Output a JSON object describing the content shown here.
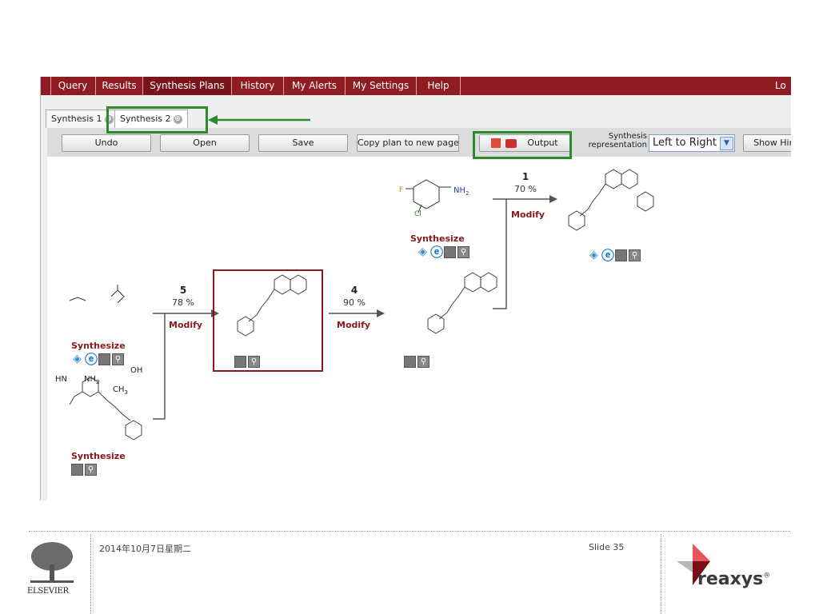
{
  "nav": {
    "items": [
      "Query",
      "Results",
      "Synthesis Plans",
      "History",
      "My Alerts",
      "My Settings",
      "Help"
    ],
    "logout": "Lo"
  },
  "tabs": [
    {
      "label": "Synthesis 1",
      "close": "⊗"
    },
    {
      "label": "Synthesis 2",
      "close": "⊗"
    }
  ],
  "toolbar": {
    "undo": "Undo",
    "open": "Open",
    "save": "Save",
    "copy": "Copy plan to new page",
    "output": "Output",
    "rep_label_1": "Synthesis",
    "rep_label_2": "representation",
    "rep_value": "Left to Right",
    "hint": "Show Hint"
  },
  "plan": {
    "step5": {
      "num": "5",
      "yield": "78 %",
      "modify": "Modify"
    },
    "step4": {
      "num": "4",
      "yield": "90 %",
      "modify": "Modify"
    },
    "step1": {
      "num": "1",
      "yield": "70 %",
      "modify": "Modify"
    },
    "synthesize": "Synthesize",
    "mol_labels": {
      "hn": "HN",
      "nh2": "NH",
      "nh2_sub": "2",
      "oh": "OH",
      "o": "O",
      "ch3": "CH",
      "ch3_sub": "3",
      "f": "F",
      "cl": "Cl",
      "nh2b": "NH",
      "nh2b_sub": "2"
    }
  },
  "footer": {
    "date": "2014年10月7日星期二",
    "slide": "Slide 35",
    "publisher": "ELSEVIER",
    "brand": "reaxys",
    "reg": "®"
  },
  "colors": {
    "brand": "#8f1b23",
    "highlight": "#2b8a2b",
    "synth_text": "#8a1a1a"
  }
}
